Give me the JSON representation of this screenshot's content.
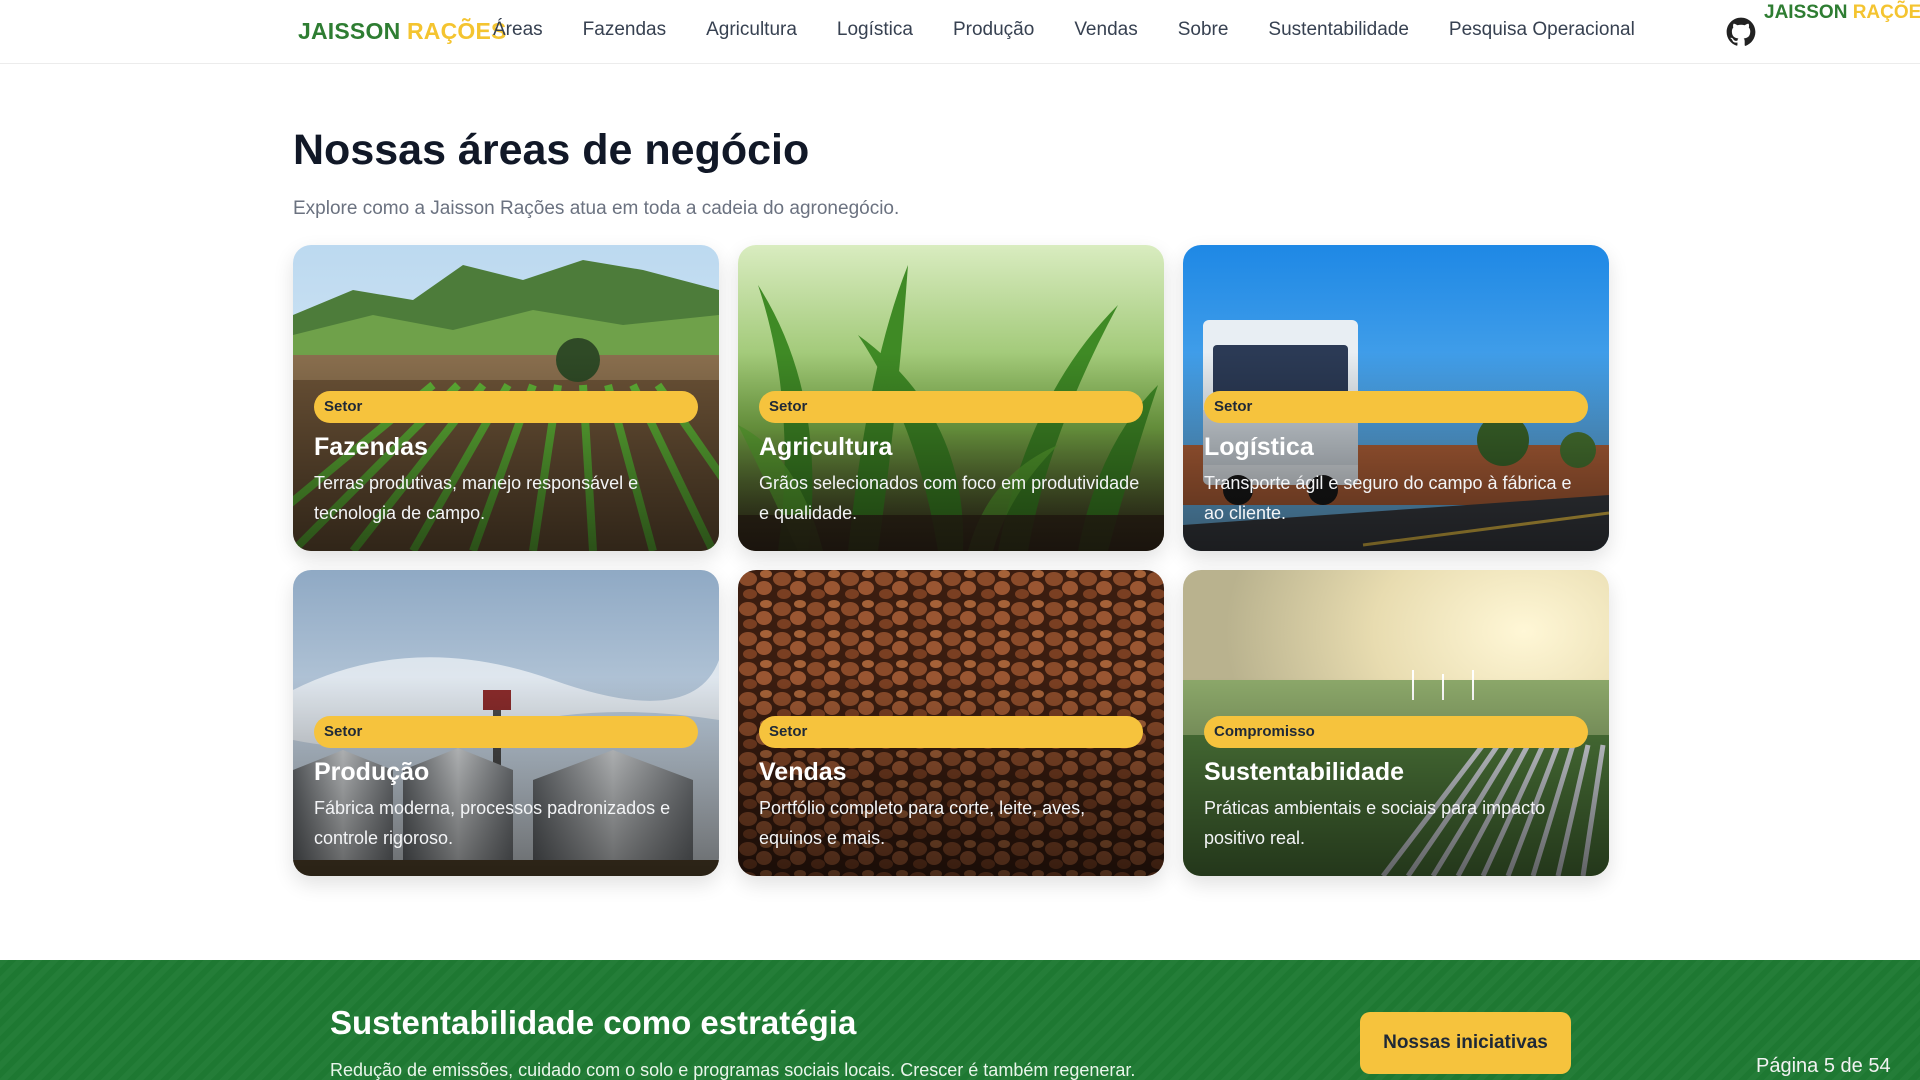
{
  "header": {
    "brand_part1": "JAISSON",
    "brand_part2": "RAÇÕES",
    "nav": [
      "Áreas",
      "Fazendas",
      "Agricultura",
      "Logística",
      "Produção",
      "Vendas",
      "Sobre",
      "Sustentabilidade",
      "Pesquisa Operacional"
    ],
    "github_icon": "github-icon",
    "corner_brand_part1": "JAISSON",
    "corner_brand_part2": "RAÇÕES"
  },
  "section": {
    "title": "Nossas áreas de negócio",
    "subtitle": "Explore como a Jaisson Rações atua em toda a cadeia do agronegócio."
  },
  "cards": [
    {
      "tag": "Setor",
      "title": "Fazendas",
      "desc": "Terras produtivas, manejo responsável e tecnologia de campo."
    },
    {
      "tag": "Setor",
      "title": "Agricultura",
      "desc": "Grãos selecionados com foco em produtividade e qualidade."
    },
    {
      "tag": "Setor",
      "title": "Logística",
      "desc": "Transporte ágil e seguro do campo à fábrica e ao cliente."
    },
    {
      "tag": "Setor",
      "title": "Produção",
      "desc": "Fábrica moderna, processos padronizados e controle rigoroso."
    },
    {
      "tag": "Setor",
      "title": "Vendas",
      "desc": "Portfólio completo para corte, leite, aves, equinos e mais."
    },
    {
      "tag": "Compromisso",
      "title": "Sustentabilidade",
      "desc": "Práticas ambientais e sociais para impacto positivo real."
    }
  ],
  "band": {
    "title": "Sustentabilidade como estratégia",
    "text": "Redução de emissões, cuidado com o solo e programas sociais locais. Crescer é também regenerar.",
    "button": "Nossas iniciativas"
  },
  "page_indicator": "Página 5 de 54",
  "colors": {
    "brand_green": "#2e7d32",
    "brand_yellow": "#f4c430",
    "band_green": "#1f7a33",
    "pill_yellow": "#f6c33d"
  }
}
